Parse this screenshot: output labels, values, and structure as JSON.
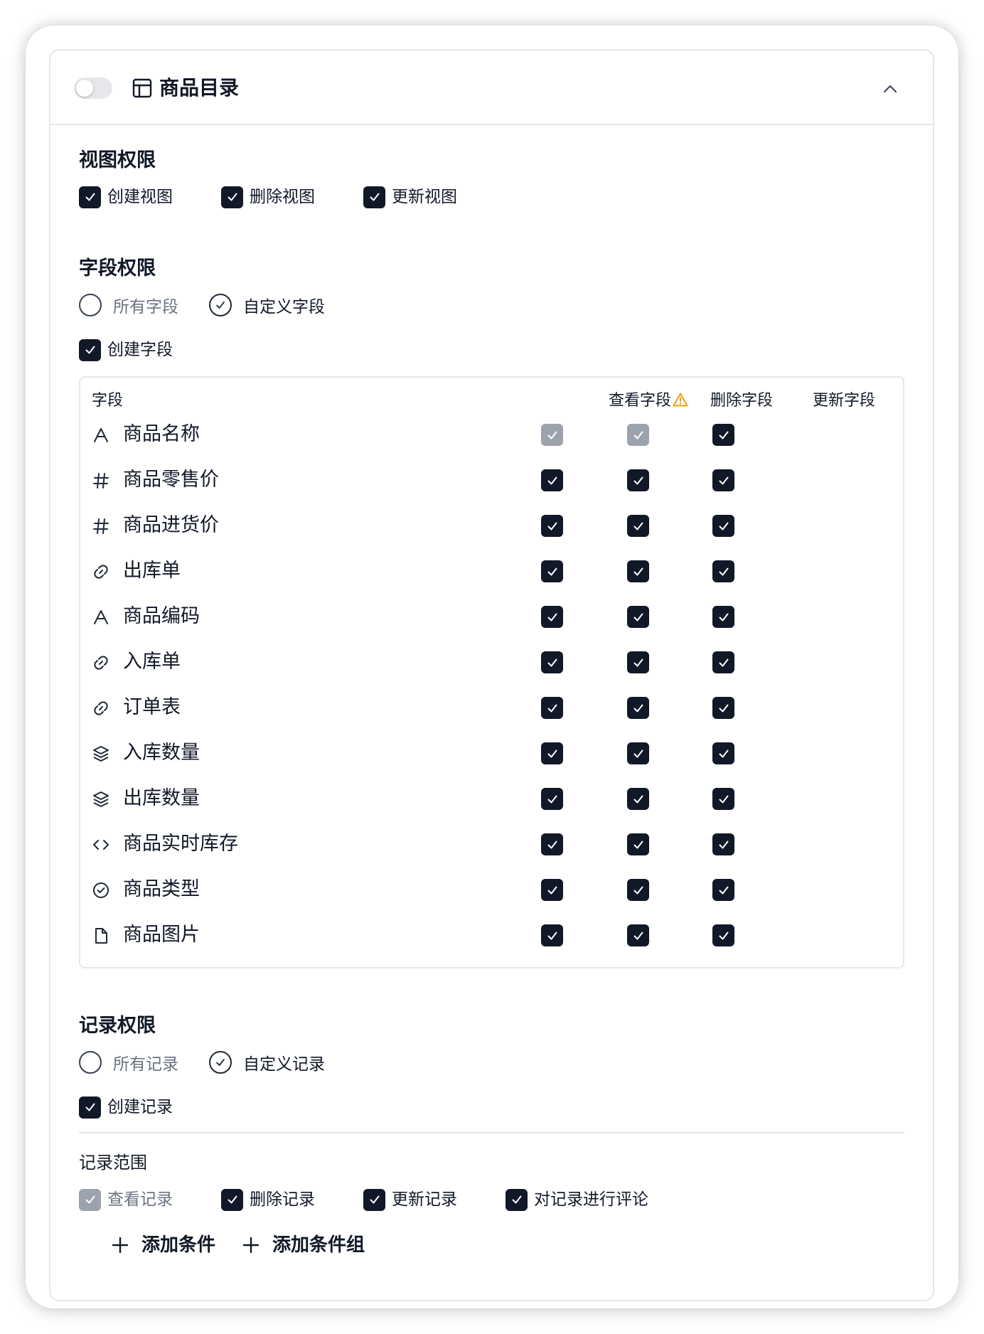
{
  "header": {
    "title": "商品目录",
    "toggle_on": false
  },
  "view_permissions": {
    "title": "视图权限",
    "items": [
      {
        "label": "创建视图",
        "checked": true
      },
      {
        "label": "删除视图",
        "checked": true
      },
      {
        "label": "更新视图",
        "checked": true
      }
    ]
  },
  "field_permissions": {
    "title": "字段权限",
    "radios": [
      {
        "label": "所有字段",
        "selected": false
      },
      {
        "label": "自定义字段",
        "selected": true
      }
    ],
    "create_label": "创建字段",
    "create_checked": true,
    "table": {
      "headers": [
        "字段",
        "查看字段",
        "删除字段",
        "更新字段"
      ],
      "view_header_warning_icon": "warning-icon",
      "rows": [
        {
          "icon": "text-icon",
          "name": "商品名称",
          "view": "disabled",
          "delete": "disabled",
          "update": "checked"
        },
        {
          "icon": "hash-icon",
          "name": "商品零售价",
          "view": "checked",
          "delete": "checked",
          "update": "checked"
        },
        {
          "icon": "hash-icon",
          "name": "商品进货价",
          "view": "checked",
          "delete": "checked",
          "update": "checked"
        },
        {
          "icon": "link-icon",
          "name": "出库单",
          "view": "checked",
          "delete": "checked",
          "update": "checked"
        },
        {
          "icon": "text-icon",
          "name": "商品编码",
          "view": "checked",
          "delete": "checked",
          "update": "checked"
        },
        {
          "icon": "link-icon",
          "name": "入库单",
          "view": "checked",
          "delete": "checked",
          "update": "checked"
        },
        {
          "icon": "link-icon",
          "name": "订单表",
          "view": "checked",
          "delete": "checked",
          "update": "checked"
        },
        {
          "icon": "layers-icon",
          "name": "入库数量",
          "view": "checked",
          "delete": "checked",
          "update": "checked"
        },
        {
          "icon": "layers-icon",
          "name": "出库数量",
          "view": "checked",
          "delete": "checked",
          "update": "checked"
        },
        {
          "icon": "code-icon",
          "name": "商品实时库存",
          "view": "checked",
          "delete": "checked",
          "update": "checked"
        },
        {
          "icon": "circle-check-icon",
          "name": "商品类型",
          "view": "checked",
          "delete": "checked",
          "update": "checked"
        },
        {
          "icon": "file-icon",
          "name": "商品图片",
          "view": "checked",
          "delete": "checked",
          "update": "checked"
        }
      ]
    }
  },
  "record_permissions": {
    "title": "记录权限",
    "radios": [
      {
        "label": "所有记录",
        "selected": false
      },
      {
        "label": "自定义记录",
        "selected": true
      }
    ],
    "create_label": "创建记录",
    "create_checked": true,
    "scope_title": "记录范围",
    "scope_items": [
      {
        "label": "查看记录",
        "state": "disabled"
      },
      {
        "label": "删除记录",
        "state": "checked"
      },
      {
        "label": "更新记录",
        "state": "checked"
      },
      {
        "label": "对记录进行评论",
        "state": "checked"
      }
    ],
    "add_condition": "添加条件",
    "add_condition_group": "添加条件组"
  },
  "colors": {
    "checkbox_checked": "#111827",
    "checkbox_disabled": "#9ca3af",
    "border": "#e5e7eb",
    "warning": "#f59e0b"
  }
}
